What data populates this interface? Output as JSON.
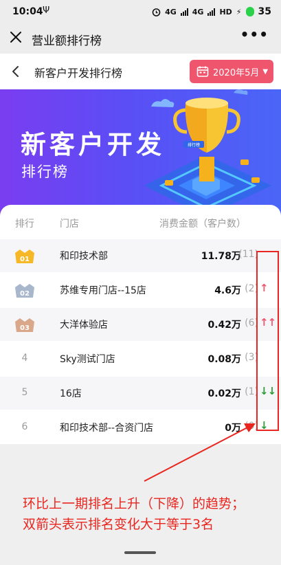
{
  "status_bar": {
    "time": "10:04",
    "usb": "Ψ",
    "net1": "4G",
    "net2": "4G",
    "wifi": "HD",
    "battery": "35"
  },
  "app_nav": {
    "title": "营业额排行榜",
    "more": "•••"
  },
  "page_header": {
    "title": "新客户开发排行榜",
    "date_button": "2020年5月",
    "caret": "▼"
  },
  "banner": {
    "title": "新客户开发",
    "subtitle": "排行榜",
    "trophy_label": "排行榜"
  },
  "table": {
    "headers": {
      "rank": "排行",
      "store": "门店",
      "amount": "消费金额（客户数）"
    },
    "rows": [
      {
        "rank": "01",
        "badge": "gold-crown",
        "store": "和印技术部",
        "amount": "11.78万",
        "count": "(11)",
        "trend": ""
      },
      {
        "rank": "02",
        "badge": "silver-crown",
        "store": "苏维专用门店--15店",
        "amount": "4.6万",
        "count": "(2)",
        "trend": "↑"
      },
      {
        "rank": "03",
        "badge": "bronze-crown",
        "store": "大洋体验店",
        "amount": "0.42万",
        "count": "(6)",
        "trend": "↑↑"
      },
      {
        "rank": "4",
        "store": "Sky测试门店",
        "amount": "0.08万",
        "count": "(3)",
        "trend": ""
      },
      {
        "rank": "5",
        "store": "16店",
        "amount": "0.02万",
        "count": "(1)",
        "trend": "↓↓"
      },
      {
        "rank": "6",
        "store": "和印技术部--合资门店",
        "amount": "0万",
        "count": "(0)",
        "trend": "↓"
      }
    ]
  },
  "annotation": {
    "line1": "环比上一期排名上升（下降）的趋势；",
    "line2": "双箭头表示排名变化大于等于3名",
    "color": "#e8261f"
  },
  "colors": {
    "accent": "#f0556e",
    "up": "#f0556e",
    "down": "#2d9a38",
    "banner_start": "#7a3df0",
    "banner_end": "#4a66f7"
  }
}
